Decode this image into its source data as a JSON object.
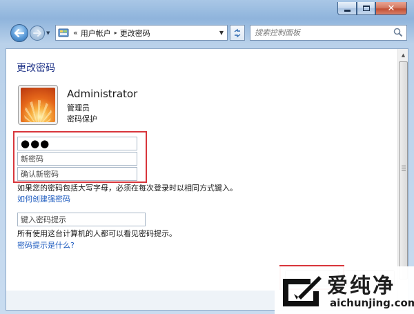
{
  "window": {
    "controls": {
      "minimize": "",
      "maximize": "",
      "close": ""
    }
  },
  "nav": {
    "address": {
      "prefix": "«",
      "crumb1": "用户帐户",
      "separator": "▸",
      "crumb2": "更改密码"
    },
    "search": {
      "placeholder": "搜索控制面板"
    }
  },
  "page": {
    "title": "更改密码",
    "user": {
      "name": "Administrator",
      "role": "管理员",
      "protection": "密码保护"
    },
    "fields": {
      "current_password": "●●●",
      "new_password_placeholder": "新密码",
      "confirm_password_placeholder": "确认新密码",
      "hint_placeholder": "键入密码提示"
    },
    "notice": "如果您的密码包括大写字母，必须在每次登录时以相同方式键入。",
    "strong_password_link": "如何创建强密码",
    "hint_info": "所有使用这台计算机的人都可以看见密码提示。",
    "hint_help_link": "密码提示是什么?"
  },
  "watermark": {
    "brand": "爱纯净",
    "url": "aichunjing.com"
  },
  "colors": {
    "title_blue": "#1e3287",
    "link_blue": "#1d5bbf",
    "highlight_red": "#d8353b"
  },
  "icons": [
    "back-arrow-icon",
    "forward-arrow-icon",
    "control-panel-icon",
    "refresh-icon",
    "search-icon",
    "user-avatar-icon"
  ]
}
